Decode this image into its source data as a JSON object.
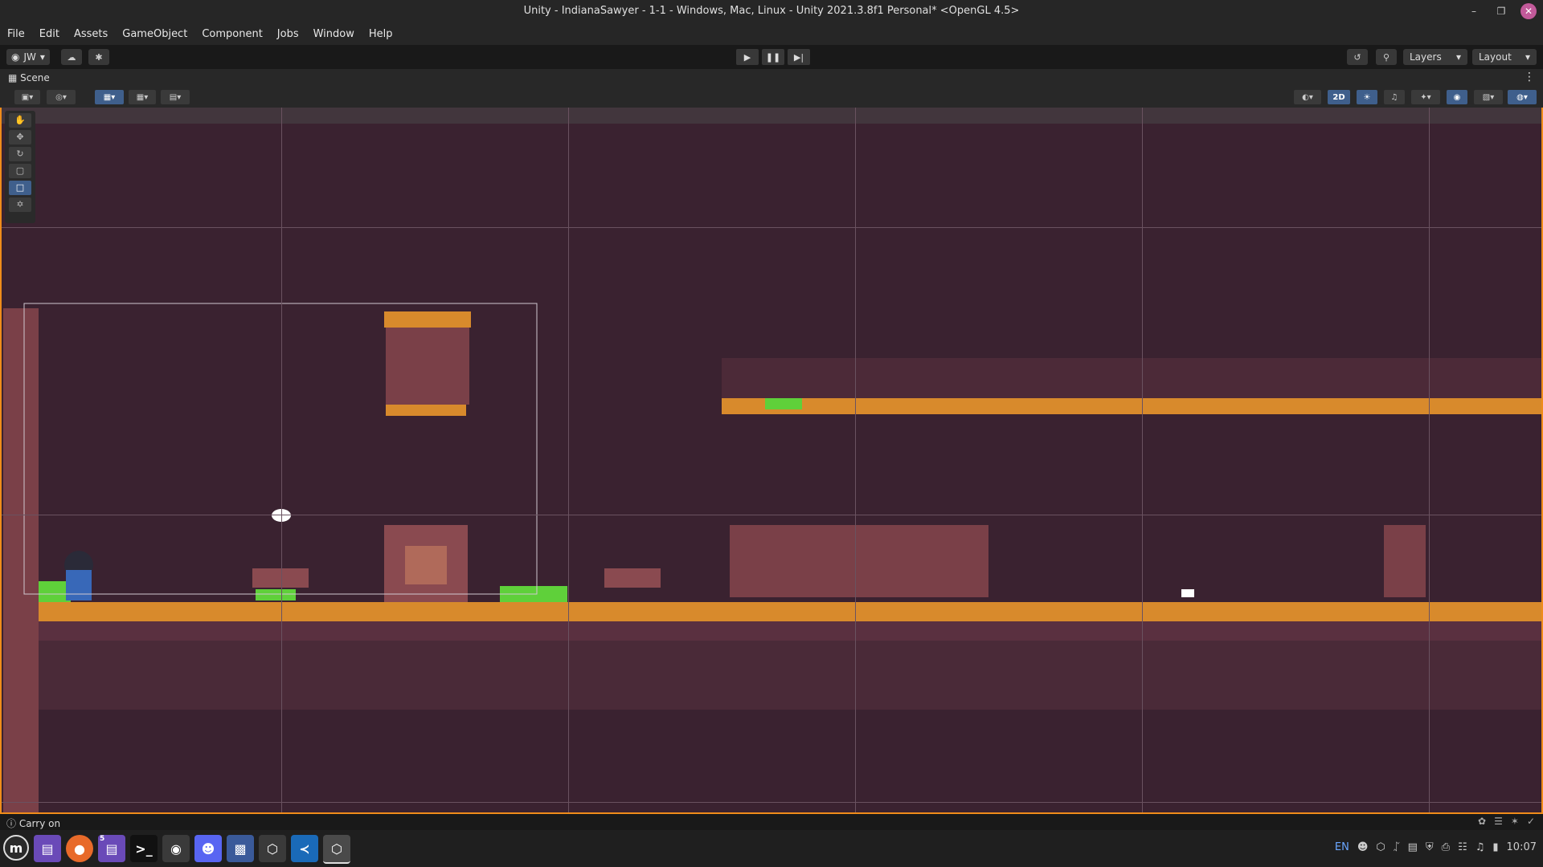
{
  "window": {
    "title": "Unity - IndianaSawyer - 1-1 - Windows, Mac, Linux - Unity 2021.3.8f1 Personal* <OpenGL 4.5>"
  },
  "menu": [
    "File",
    "Edit",
    "Assets",
    "GameObject",
    "Component",
    "Jobs",
    "Window",
    "Help"
  ],
  "toolbar": {
    "account": "JW",
    "layers": "Layers",
    "layout": "Layout"
  },
  "scene": {
    "tab_label": "Scene",
    "mode_2d": "2D"
  },
  "status": {
    "message": "Carry on"
  },
  "taskbar": {
    "badge": "5"
  },
  "tray": {
    "lang": "EN",
    "clock": "10:07"
  },
  "colors": {
    "accent": "#f08c1a",
    "scene_bg": "#3a2230",
    "brick": "#8a4a50",
    "ground": "#d88a2c",
    "grass": "#5fd03a",
    "close": "#c25a9a"
  }
}
